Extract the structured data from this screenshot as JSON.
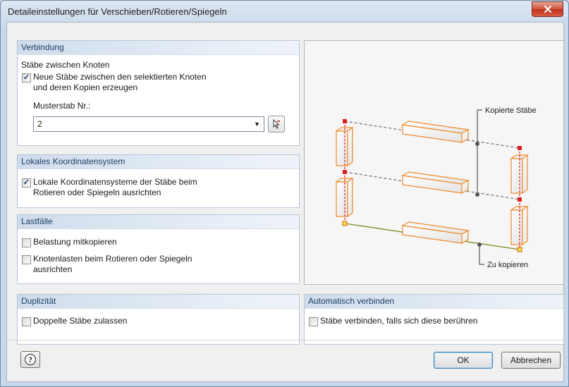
{
  "window": {
    "title": "Detaileinstellungen für Verschieben/Rotieren/Spiegeln"
  },
  "verbindung": {
    "header": "Verbindung",
    "subheading": "Stäbe zwischen Knoten",
    "checkbox_label_line1": "Neue Stäbe zwischen den selektierten Knoten",
    "checkbox_label_line2": "und deren Kopien erzeugen",
    "checkbox_checked": true,
    "musterstab_label": "Musterstab Nr.:",
    "musterstab_value": "2"
  },
  "koordinaten": {
    "header": "Lokales Koordinatensystem",
    "checkbox_label_line1": "Lokale Koordinatensysteme der Stäbe beim",
    "checkbox_label_line2": "Rotieren oder Spiegeln ausrichten",
    "checkbox_checked": true
  },
  "lastfaelle": {
    "header": "Lastfälle",
    "item1_label": "Belastung mitkopieren",
    "item1_checked": false,
    "item2_label_line1": "Knotenlasten beim Rotieren oder Spiegeln",
    "item2_label_line2": "ausrichten",
    "item2_checked": false
  },
  "duplizitaet": {
    "header": "Duplizität",
    "checkbox_label": "Doppelte Stäbe zulassen",
    "checkbox_checked": false
  },
  "auto_verbinden": {
    "header": "Automatisch verbinden",
    "checkbox_label": "Stäbe verbinden, falls sich diese berühren",
    "checkbox_checked": false
  },
  "preview": {
    "label_copied": "Kopierte Stäbe",
    "label_to_copy": "Zu kopieren"
  },
  "buttons": {
    "ok": "OK",
    "cancel": "Abbrechen"
  },
  "colors": {
    "accent_orange": "#f08a2a",
    "node_red": "#e02020",
    "header_text": "#1e3f66"
  }
}
